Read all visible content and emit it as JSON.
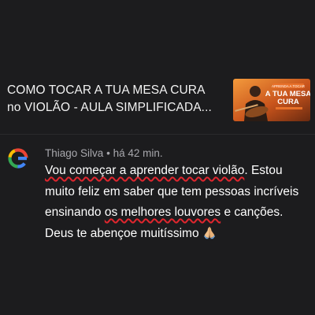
{
  "video": {
    "title": "COMO TOCAR A TUA MESA CURA\nno VIOLÃO  - AULA SIMPLIFICADA...",
    "thumbnail": {
      "badge": "APRENDA A TOCAR",
      "line1": "A TUA MESA",
      "line2": "CURA",
      "accent_color": "#e8712a"
    }
  },
  "comment": {
    "avatar_icon": "google-g-icon",
    "author": "Thiago Silva",
    "separator": "•",
    "time": "há 42 min.",
    "parts": {
      "p1": "Vou começar a aprender tocar violão",
      "p2": ". Estou muito feliz em saber que tem pessoas incríveis ensinando ",
      "p3": "os melhores louvores",
      "p4": " e canções. Deus te abençoe muitíssimo "
    },
    "emoji_icon": "praying-hands-icon",
    "spellcheck_color": "#e0262e"
  }
}
